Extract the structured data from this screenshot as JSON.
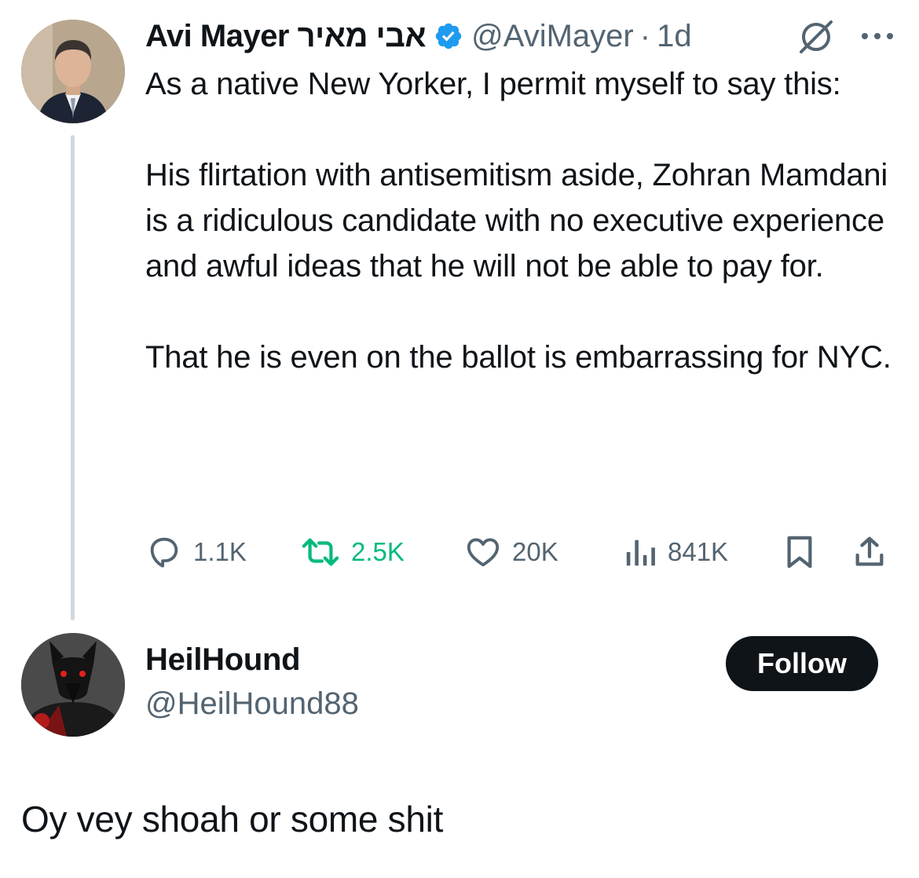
{
  "tweet": {
    "author": {
      "display_name": "Avi Mayer אבי מאיר",
      "handle": "@AviMayer",
      "verified": true,
      "avatar_icon": "profile-photo"
    },
    "time": "1d",
    "separator": "·",
    "text": "As a native New Yorker, I permit myself to say this:\n\nHis flirtation with antisemitism aside, Zohran Mamdani is a ridiculous candidate with no executive experience and awful ideas that he will not be able to pay for.\n\nThat he is even on the ballot is embarrassing for NYC.",
    "actions": {
      "replies": "1.1K",
      "retweets": "2.5K",
      "likes": "20K",
      "views": "841K"
    },
    "colors": {
      "verified": "#1d9bf0",
      "retweet": "#00ba7c",
      "muted": "#536471"
    }
  },
  "reply": {
    "author": {
      "display_name": "HeilHound",
      "handle": "@HeilHound88",
      "avatar_icon": "wolf-profile-image"
    },
    "follow_label": "Follow",
    "text": "Oy vey shoah or some shit"
  }
}
